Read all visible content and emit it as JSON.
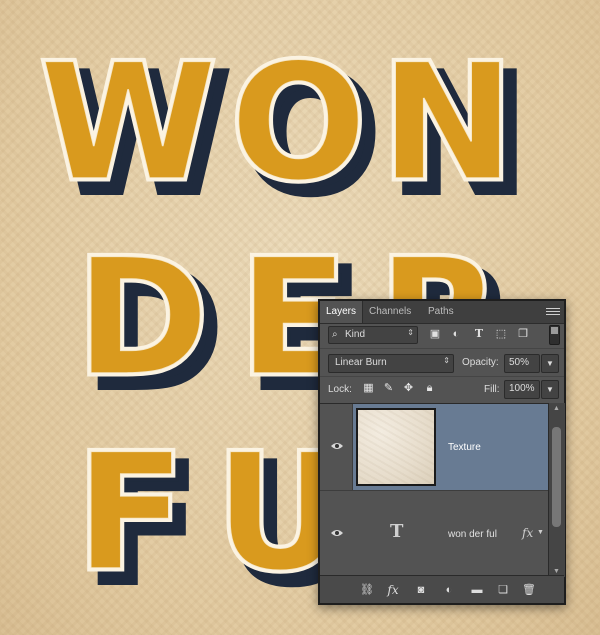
{
  "artwork": {
    "lines": [
      "WON",
      "DER",
      "FUL"
    ]
  },
  "layers_panel": {
    "tabs": [
      "Layers",
      "Channels",
      "Paths"
    ],
    "filter": {
      "kind_label": "Kind"
    },
    "blend_mode": "Linear Burn",
    "opacity_label": "Opacity:",
    "opacity_value": "50%",
    "lock_label": "Lock:",
    "fill_label": "Fill:",
    "fill_value": "100%",
    "layers": [
      {
        "name": "Texture",
        "selected": true,
        "visible": true
      },
      {
        "name": "won der ful",
        "selected": false,
        "visible": true,
        "has_effects": true,
        "effects_label": "fx"
      }
    ],
    "bottom_icons": [
      "link-icon",
      "fx-icon",
      "mask-icon",
      "adjustment-icon",
      "folder-icon",
      "new-layer-icon",
      "trash-icon"
    ]
  },
  "colors": {
    "letter_fill": "#d99a1e",
    "letter_stroke": "#fbf3e2",
    "shadow_dark": "#1f2a3d",
    "selected_layer": "#687b93"
  }
}
